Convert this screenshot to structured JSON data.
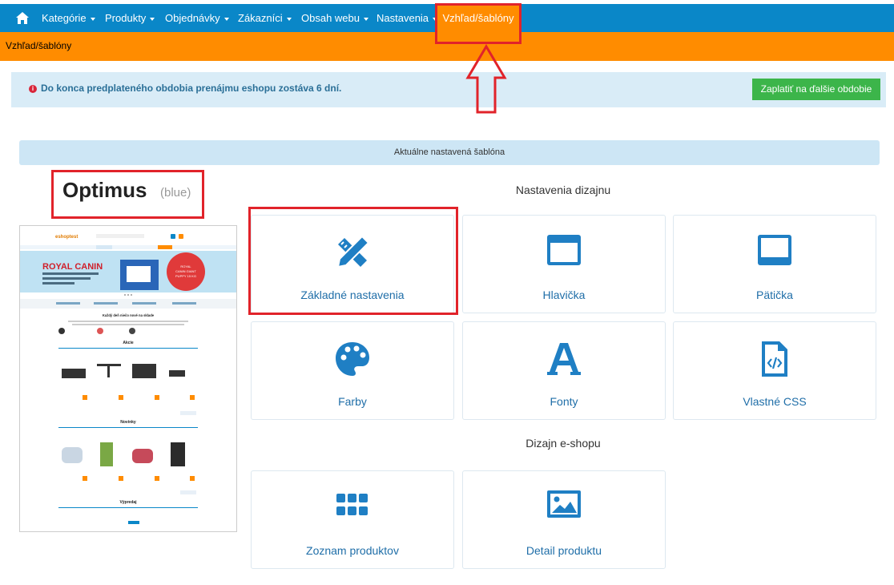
{
  "nav": {
    "items": [
      {
        "label": "Kategórie",
        "dropdown": true
      },
      {
        "label": "Produkty",
        "dropdown": true
      },
      {
        "label": "Objednávky",
        "dropdown": true
      },
      {
        "label": "Zákazníci",
        "dropdown": true
      },
      {
        "label": "Obsah webu",
        "dropdown": true
      },
      {
        "label": "Nastavenia",
        "dropdown": true
      }
    ],
    "active": "Vzhľad/šablóny",
    "home_icon": "home-icon",
    "color": "#0a87c8",
    "active_color": "#ff8c00"
  },
  "breadcrumb": "Vzhľad/šablóny",
  "alert": {
    "message": "Do konca predplateného obdobia prenájmu eshopu zostáva 6 dní.",
    "button": "Zaplatiť na ďalšie obdobie",
    "icon": "info-icon"
  },
  "current_template": {
    "header": "Aktuálne nastavená šablóna",
    "name": "Optimus",
    "variant": "(blue)"
  },
  "design_settings": {
    "title": "Nastavenia dizajnu",
    "cards": [
      {
        "label": "Základné nastavenia",
        "icon": "pencil-ruler-icon"
      },
      {
        "label": "Hlavička",
        "icon": "window-header-icon"
      },
      {
        "label": "Pätička",
        "icon": "window-footer-icon"
      },
      {
        "label": "Farby",
        "icon": "palette-icon"
      },
      {
        "label": "Fonty",
        "icon": "font-icon"
      },
      {
        "label": "Vlastné CSS",
        "icon": "code-file-icon"
      }
    ]
  },
  "shop_design": {
    "title": "Dizajn e-shopu",
    "cards": [
      {
        "label": "Zoznam produktov",
        "icon": "grid-icon"
      },
      {
        "label": "Detail produktu",
        "icon": "image-icon"
      }
    ]
  },
  "preview": {
    "logo": "eshoptest",
    "banner_brand": "ROYAL CANIN",
    "banner_text": "Vybrané, dobre stráviteľné bielkoviny vysokej biologickej hodnoty.",
    "banner_badge": "ROYAL CANIN GIANT PUPPY 15 KG",
    "headline": "Každý deň niečo nové na sklade",
    "section_1": "Akcie",
    "section_2": "Novinky",
    "section_3": "Výpredaj"
  }
}
